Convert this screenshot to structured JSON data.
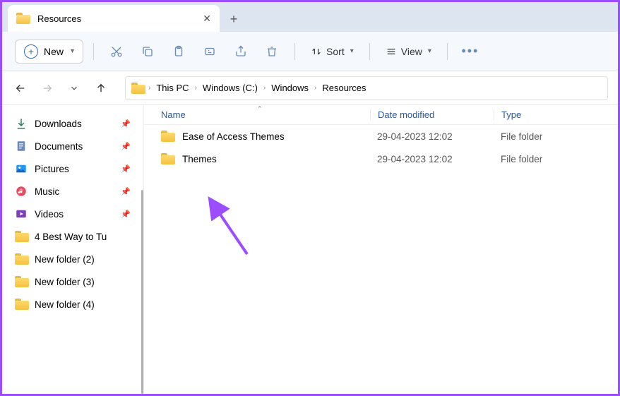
{
  "tab": {
    "title": "Resources"
  },
  "toolbar": {
    "new_label": "New",
    "sort_label": "Sort",
    "view_label": "View"
  },
  "breadcrumbs": [
    "This PC",
    "Windows (C:)",
    "Windows",
    "Resources"
  ],
  "sidebar_items": [
    {
      "id": "downloads",
      "label": "Downloads",
      "pinned": true,
      "icon": "download"
    },
    {
      "id": "documents",
      "label": "Documents",
      "pinned": true,
      "icon": "document"
    },
    {
      "id": "pictures",
      "label": "Pictures",
      "pinned": true,
      "icon": "pictures"
    },
    {
      "id": "music",
      "label": "Music",
      "pinned": true,
      "icon": "music"
    },
    {
      "id": "videos",
      "label": "Videos",
      "pinned": true,
      "icon": "videos"
    },
    {
      "id": "4best",
      "label": "4 Best Way to Tu",
      "pinned": false,
      "icon": "folder"
    },
    {
      "id": "nf2",
      "label": "New folder (2)",
      "pinned": false,
      "icon": "folder"
    },
    {
      "id": "nf3",
      "label": "New folder (3)",
      "pinned": false,
      "icon": "folder"
    },
    {
      "id": "nf4",
      "label": "New folder (4)",
      "pinned": false,
      "icon": "folder"
    }
  ],
  "columns": {
    "name": "Name",
    "date": "Date modified",
    "type": "Type"
  },
  "files": [
    {
      "name": "Ease of Access Themes",
      "date": "29-04-2023 12:02",
      "type": "File folder"
    },
    {
      "name": "Themes",
      "date": "29-04-2023 12:02",
      "type": "File folder"
    }
  ]
}
